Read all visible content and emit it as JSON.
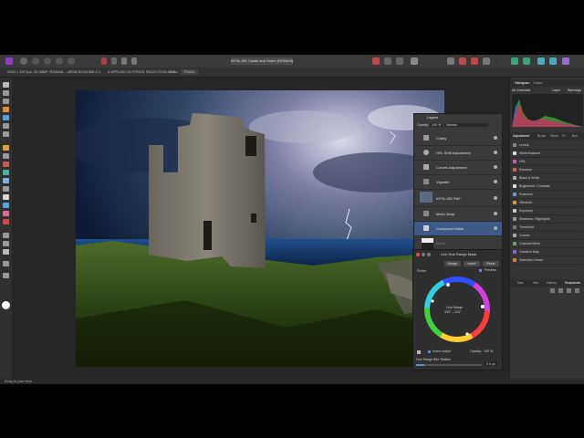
{
  "colors": {
    "accent": "#5b8fd6",
    "panel": "#353535",
    "canvas": "#262626",
    "affinity": "#8e3ec8"
  },
  "document": {
    "tab_title": "#STA-180 Castle and Storm (RGBA/8)"
  },
  "context_bar": {
    "left_info": "2629 × 2971px, 29.38MP, RGBA/8 – sRGB IEC61966-2.1",
    "middle_info": "4 APPLIED 25 FORCE SELECTION AB 1",
    "label": "Listo:",
    "value": "Pixelo"
  },
  "right_panel": {
    "top_tabs": [
      "Histogram",
      "Colour"
    ],
    "channel_select": "All Channels",
    "channel_btns": [
      "Layer",
      "Warnings"
    ],
    "adj_tabs": [
      "Adjustment",
      "Brush",
      "Stock",
      "Fx",
      "Bra"
    ],
    "adjustments": [
      "Levels",
      "White Balance",
      "HSL",
      "Recolour",
      "Black & White",
      "Brightness / Contrast",
      "Posterise",
      "Vibrance",
      "Exposure",
      "Shadows / Highlights",
      "Threshold",
      "Curves",
      "Channel Mixer",
      "Gradient Map",
      "Selective Colour"
    ],
    "bottom_tabs": [
      "Nav",
      "Info",
      "History",
      "Snapshots"
    ]
  },
  "layers_panel": {
    "title": "Layers",
    "opacity_label": "Opacity:",
    "opacity_value": "100 %",
    "blend_mode": "Normal",
    "rows": [
      {
        "name": "Clarity"
      },
      {
        "name": "HSL Shift Adjustment"
      },
      {
        "name": "Curves Adjustment"
      },
      {
        "name": "Vignette"
      },
      {
        "name": "#STA-180 RAF"
      },
      {
        "name": "Mesh Warp"
      },
      {
        "name": "Compound Mask"
      },
      {
        "name": "Blank"
      }
    ]
  },
  "hsl_dialog": {
    "title": "Live Hue Range Mask",
    "buttons": [
      "Merge",
      "Invert",
      "Reset"
    ],
    "mode": "Picker",
    "preview_label": "Preview",
    "center_text_1": "Hue Range",
    "center_text_2": "330° – 231°",
    "invert_output": "Invert output",
    "opacity_label": "Opacity:",
    "opacity_value": "100 %",
    "slider_label": "Hue Range Blur Radius",
    "slider_value": "0.0 px",
    "slider_fraction": 0.12
  },
  "status_bar": {
    "text": "Drag to pan view"
  }
}
